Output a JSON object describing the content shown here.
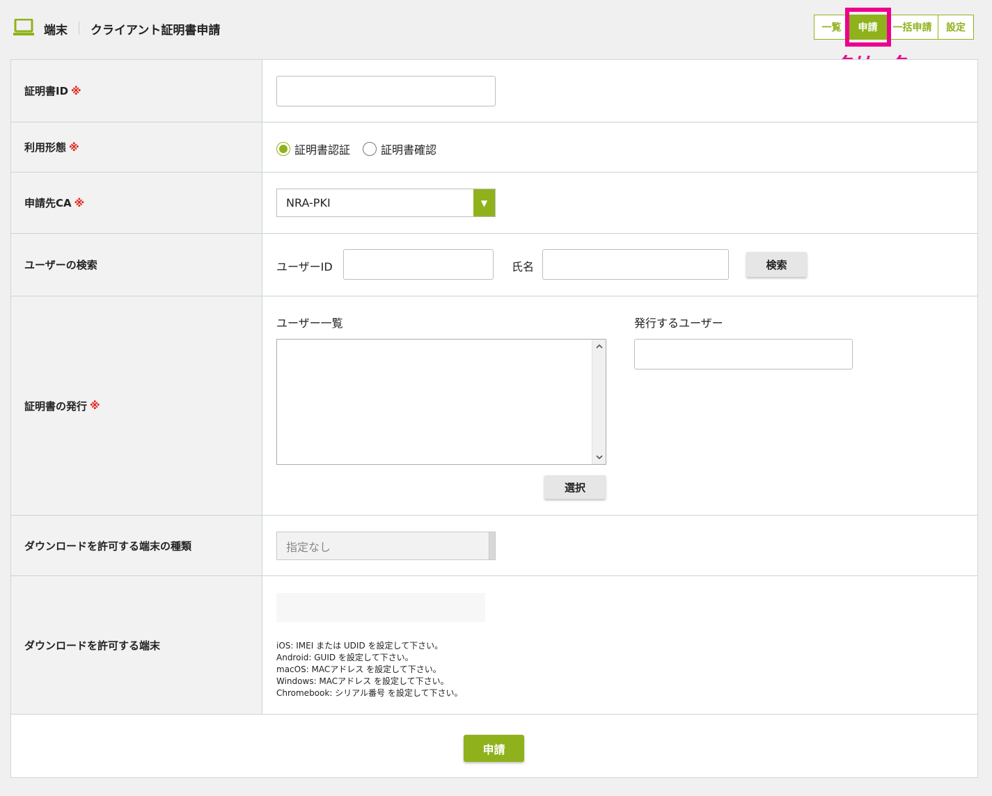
{
  "header": {
    "breadcrumb_1": "端末",
    "breadcrumb_2": "クライアント証明書申請",
    "nav": [
      {
        "label": "一覧",
        "active": false
      },
      {
        "label": "申請",
        "active": true
      },
      {
        "label": "一括申請",
        "active": false
      },
      {
        "label": "設定",
        "active": false
      }
    ],
    "annotation": "クリック",
    "accent_color": "#8fb21c",
    "annotation_color": "#ec008c"
  },
  "form": {
    "required_mark": "※",
    "cert_id": {
      "label": "証明書ID",
      "value": ""
    },
    "usage": {
      "label": "利用形態",
      "options": [
        "証明書認証",
        "証明書確認"
      ],
      "selected": "証明書認証"
    },
    "ca": {
      "label": "申請先CA",
      "value": "NRA-PKI"
    },
    "user_search": {
      "label": "ユーザーの検索",
      "user_id_label": "ユーザーID",
      "name_label": "氏名",
      "search_button": "検索"
    },
    "issue": {
      "label": "証明書の発行",
      "user_list_label": "ユーザー一覧",
      "issue_users_label": "発行するユーザー",
      "select_button": "選択"
    },
    "device_type": {
      "label": "ダウンロードを許可する端末の種類",
      "value": "指定なし"
    },
    "device": {
      "label": "ダウンロードを許可する端末",
      "help": [
        "iOS: IMEI または UDID を設定して下さい。",
        "Android: GUID を設定して下さい。",
        "macOS: MACアドレス を設定して下さい。",
        "Windows: MACアドレス を設定して下さい。",
        "Chromebook: シリアル番号 を設定して下さい。"
      ]
    },
    "submit_button": "申請"
  }
}
